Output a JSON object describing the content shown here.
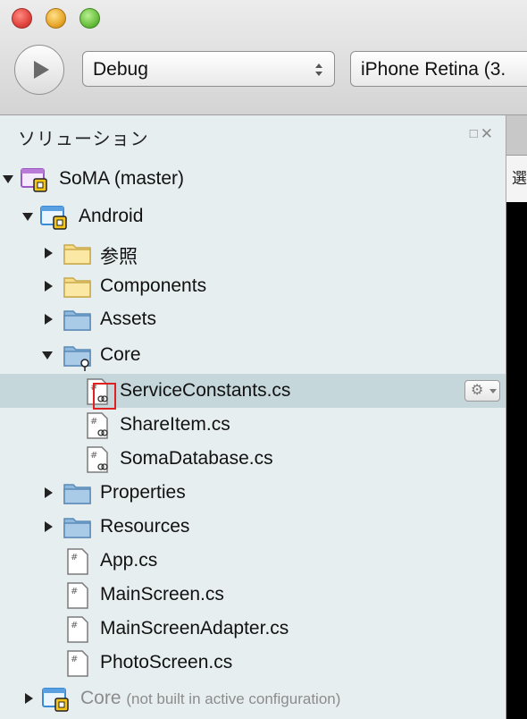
{
  "toolbar": {
    "configuration": "Debug",
    "target_device": "iPhone Retina (3."
  },
  "solution_pad": {
    "title": "ソリューション",
    "header_icons": [
      "pin-icon",
      "close-icon"
    ]
  },
  "right_pane_tab_label": "選",
  "tree": {
    "solution": "SoMA (master)",
    "android_project": "Android",
    "ref_folder": "参照",
    "components_folder": "Components",
    "assets_folder": "Assets",
    "core_folder": "Core",
    "file_service_constants": "ServiceConstants.cs",
    "file_share_item": "ShareItem.cs",
    "file_soma_database": "SomaDatabase.cs",
    "properties_folder": "Properties",
    "resources_folder": "Resources",
    "file_app": "App.cs",
    "file_main_screen": "MainScreen.cs",
    "file_main_screen_adapter": "MainScreenAdapter.cs",
    "file_photo_screen": "PhotoScreen.cs",
    "core_project": "Core",
    "core_project_note": "(not built in active configuration)"
  },
  "colors": {
    "selection": "#c6d7dc",
    "pad_background": "#e7eef0",
    "highlight": "#e02020"
  }
}
